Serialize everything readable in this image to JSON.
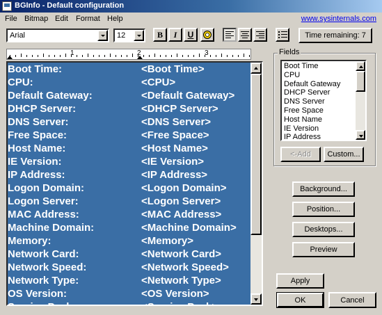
{
  "window": {
    "title": "BGInfo - Default configuration"
  },
  "menu": {
    "items": [
      "File",
      "Bitmap",
      "Edit",
      "Format",
      "Help"
    ],
    "link": "www.sysinternals.com"
  },
  "toolbar": {
    "font": "Arial",
    "size": "12",
    "bold": "B",
    "italic": "I",
    "underline": "U",
    "timer_label": "Time remaining: 7"
  },
  "ruler": {
    "numbers": [
      "1",
      "2",
      "3"
    ]
  },
  "editor": {
    "rows": [
      {
        "label": "Boot Time:",
        "value": "<Boot Time>"
      },
      {
        "label": "CPU:",
        "value": "<CPU>"
      },
      {
        "label": "Default Gateway:",
        "value": "<Default Gateway>"
      },
      {
        "label": "DHCP Server:",
        "value": "<DHCP Server>"
      },
      {
        "label": "DNS Server:",
        "value": "<DNS Server>"
      },
      {
        "label": "Free Space:",
        "value": "<Free Space>"
      },
      {
        "label": "Host Name:",
        "value": "<Host Name>"
      },
      {
        "label": "IE Version:",
        "value": "<IE Version>"
      },
      {
        "label": "IP Address:",
        "value": "<IP Address>"
      },
      {
        "label": "Logon Domain:",
        "value": "<Logon Domain>"
      },
      {
        "label": "Logon Server:",
        "value": "<Logon Server>"
      },
      {
        "label": "MAC Address:",
        "value": "<MAC Address>"
      },
      {
        "label": "Machine Domain:",
        "value": "<Machine Domain>"
      },
      {
        "label": "Memory:",
        "value": "<Memory>"
      },
      {
        "label": "Network Card:",
        "value": "<Network Card>"
      },
      {
        "label": "Network Speed:",
        "value": "<Network Speed>"
      },
      {
        "label": "Network Type:",
        "value": "<Network Type>"
      },
      {
        "label": "OS Version:",
        "value": "<OS Version>"
      },
      {
        "label": "Service Pack:",
        "value": "<Service Pack>"
      }
    ]
  },
  "fields": {
    "title": "Fields",
    "items": [
      "Boot Time",
      "CPU",
      "Default Gateway",
      "DHCP Server",
      "DNS Server",
      "Free Space",
      "Host Name",
      "IE Version",
      "IP Address"
    ],
    "add_label": "<-Add",
    "custom_label": "Custom..."
  },
  "buttons": {
    "background": "Background...",
    "position": "Position...",
    "desktops": "Desktops...",
    "preview": "Preview",
    "apply": "Apply",
    "ok": "OK",
    "cancel": "Cancel"
  },
  "colors": {
    "selection": "#3a6ea5",
    "chrome": "#d4d0c8",
    "link": "#0000ee"
  }
}
